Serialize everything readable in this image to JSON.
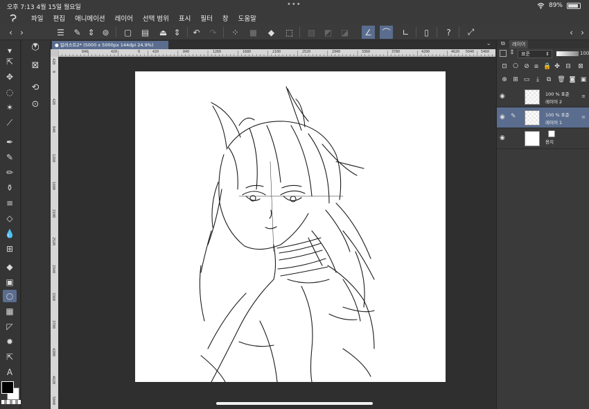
{
  "status_bar": {
    "time": "오후 7:13",
    "date": "4월 15일 월요일",
    "dots": "•••",
    "battery": "89%"
  },
  "menu": {
    "items": [
      "파일",
      "편집",
      "애니메이션",
      "레이어",
      "선택 범위",
      "표시",
      "필터",
      "창",
      "도움말"
    ]
  },
  "document": {
    "tab_label": "일러스트2* (5000 x 5000px 144dpi 24.9%)"
  },
  "ruler": {
    "top_labels": [
      "840",
      "420",
      "0",
      "420",
      "840",
      "1260",
      "1680",
      "2100",
      "2520",
      "2940",
      "3360",
      "3780",
      "4200",
      "4620",
      "5040",
      "5460"
    ],
    "left_labels": [
      "420",
      "0",
      "420",
      "840",
      "1260",
      "1680",
      "2100",
      "2520",
      "2940",
      "3360",
      "3780",
      "4200",
      "4620",
      "5040"
    ]
  },
  "layer_panel": {
    "tab_label": "레이어",
    "blend_mode": "표준",
    "opacity": "100",
    "layers": [
      {
        "name": "레이어 2",
        "info": "100 % 표준",
        "selected": false,
        "editing": false
      },
      {
        "name": "레이어 1",
        "info": "100 % 표준",
        "selected": true,
        "editing": true
      },
      {
        "name": "용지",
        "info": "",
        "selected": false,
        "editing": false
      }
    ]
  },
  "colors": {
    "accent": "#5a6d8f",
    "main_color": "#000000",
    "sub_color": "#ffffff"
  }
}
